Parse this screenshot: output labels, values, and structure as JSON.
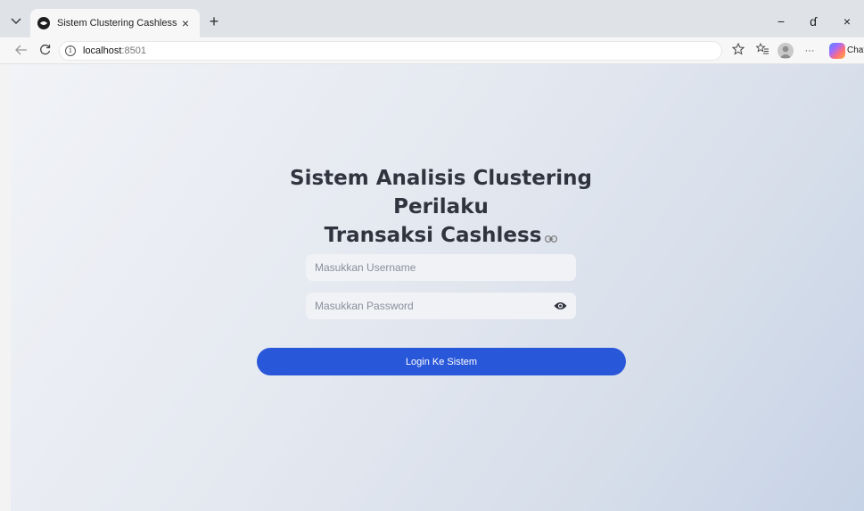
{
  "browser": {
    "tab_title": "Sistem Clustering Cashless",
    "url_host": "localhost",
    "url_port": ":8501",
    "chat_label": "Chat",
    "minimize_glyph": "−",
    "restore_glyph": "ɗ",
    "close_glyph": "×",
    "new_tab_glyph": "+",
    "tab_close_glyph": "×",
    "more_glyph": "···"
  },
  "page": {
    "title_line1": "Sistem Analisis Clustering Perilaku",
    "title_line2": "Transaksi Cashless",
    "username_placeholder": "Masukkan Username",
    "password_placeholder": "Masukkan Password",
    "login_label": "Login Ke Sistem",
    "accent_color": "#2957d9"
  },
  "icons": [
    "tab-list-chevron-icon",
    "streamlit-favicon-icon",
    "back-arrow-icon",
    "reload-icon",
    "info-icon",
    "favorite-star-icon",
    "favorites-list-icon",
    "profile-avatar-icon",
    "copilot-icon",
    "link-anchor-icon",
    "show-password-eye-icon"
  ]
}
